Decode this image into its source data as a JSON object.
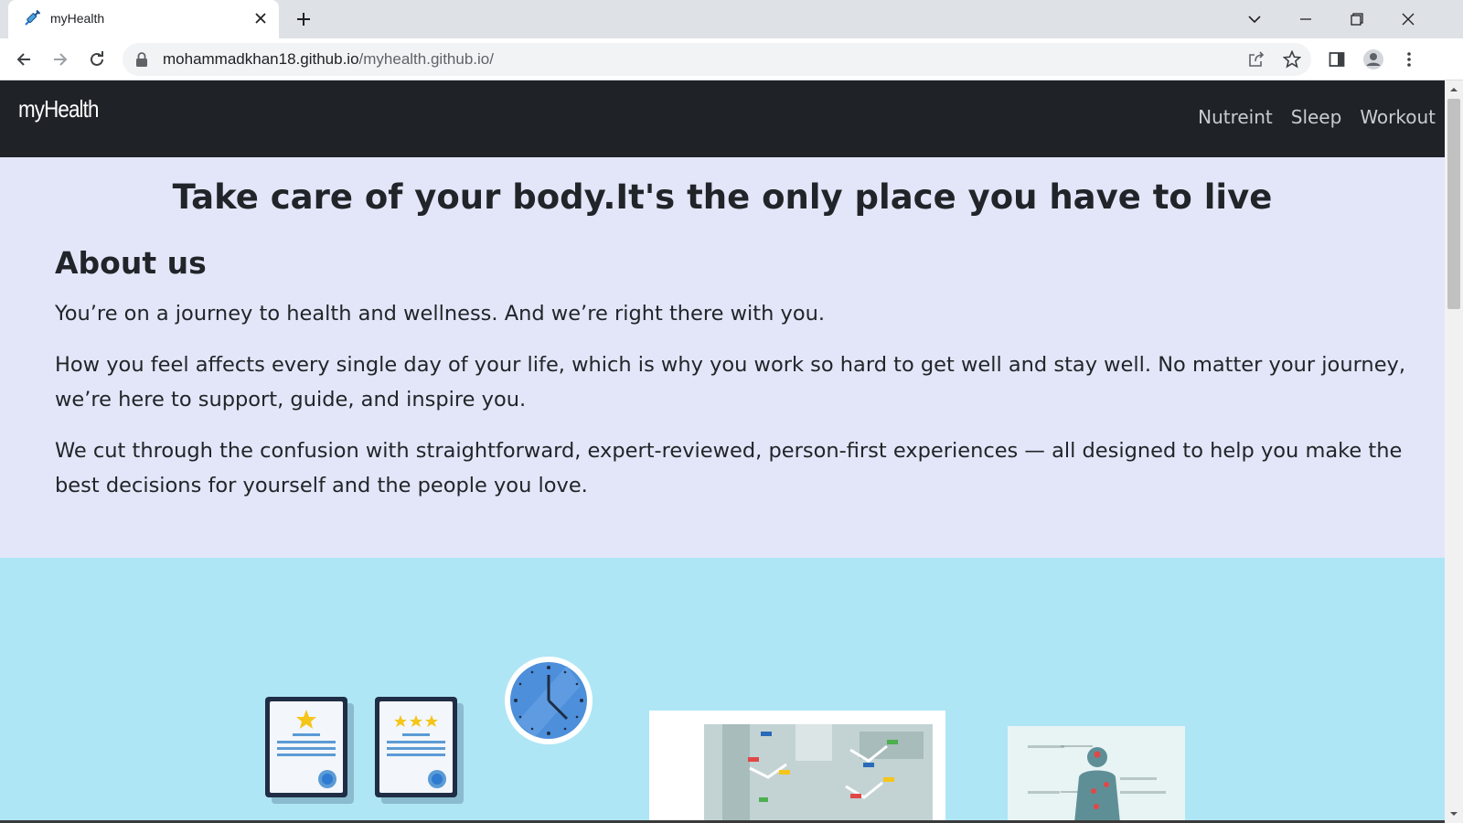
{
  "browser": {
    "tab_title": "myHealth",
    "url_domain": "mohammadkhan18.github.io",
    "url_path": "/myhealth.github.io/"
  },
  "site": {
    "brand": "myHealth",
    "nav": [
      "Nutreint",
      "Sleep",
      "Workout"
    ]
  },
  "main": {
    "hero_title": "Take care of your body.It's the only place you have to live",
    "about_heading": "About us",
    "paragraphs": [
      "You’re on a journey to health and wellness. And we’re right there with you.",
      "How you feel affects every single day of your life, which is why you work so hard to get well and stay well. No matter your journey, we’re here to support, guide, and inspire you.",
      "We cut through the confusion with straightforward, expert-reviewed, person-first experiences — all designed to help you make the best decisions for yourself and the people you love."
    ]
  },
  "colors": {
    "nav_bg": "#1f2227",
    "page_bg": "#e3e6f8",
    "illustration_bg": "#aee6f5"
  }
}
